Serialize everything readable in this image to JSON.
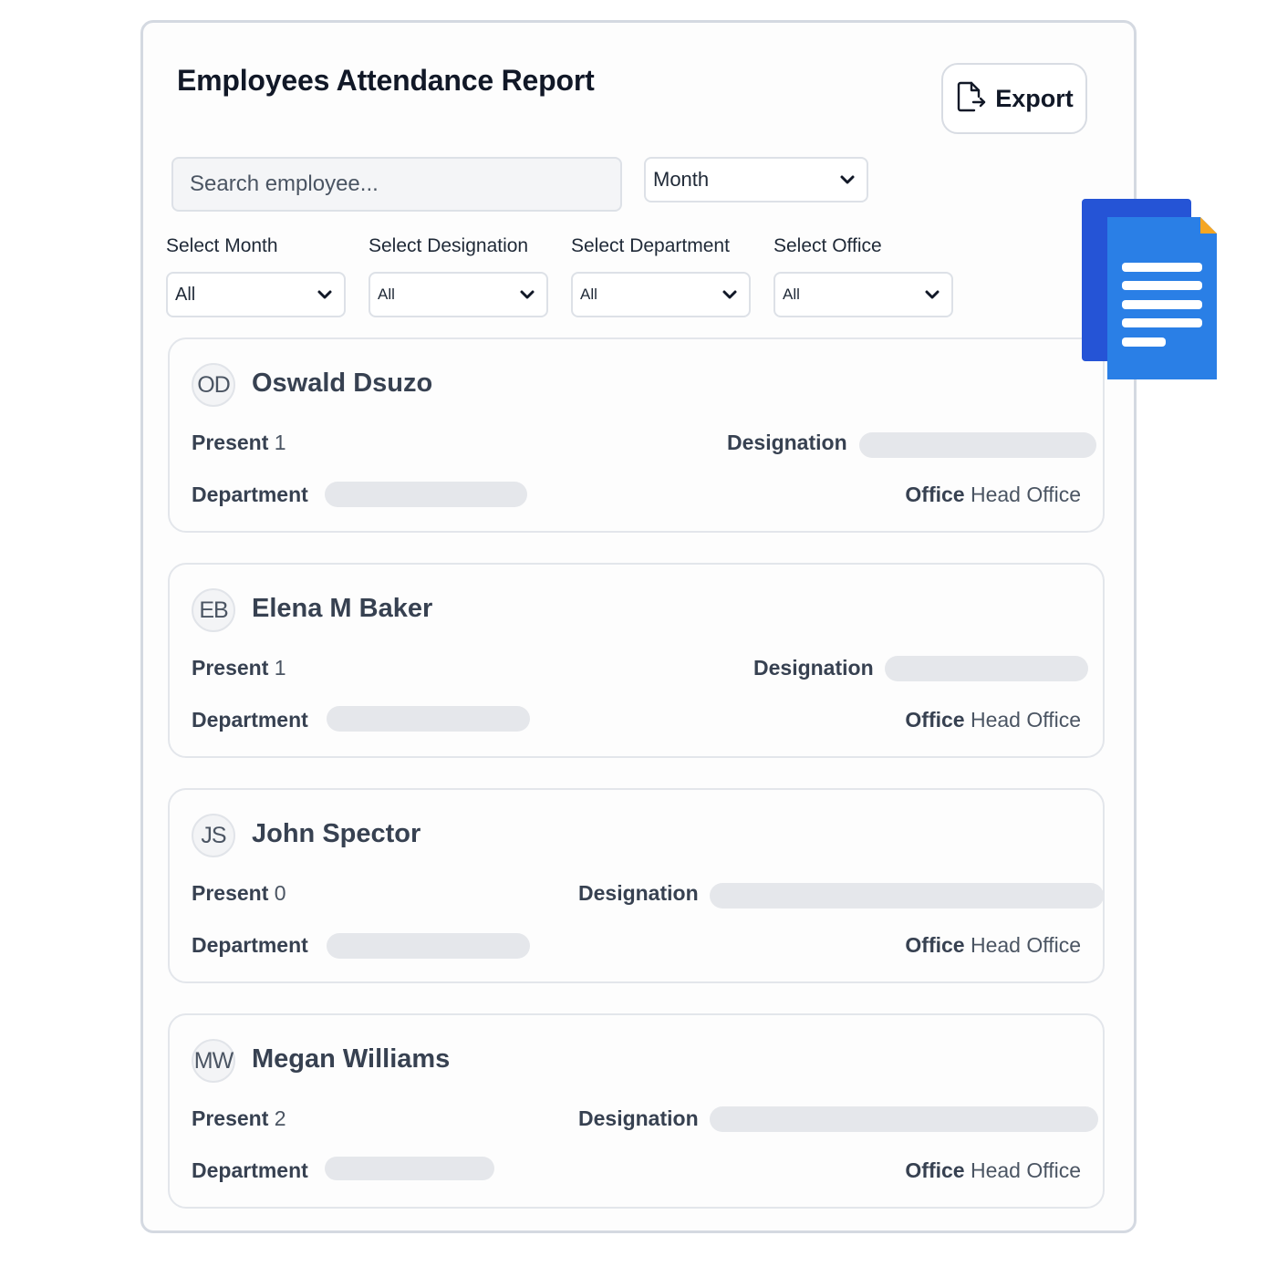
{
  "header": {
    "title": "Employees Attendance Report",
    "export_label": "Export"
  },
  "toolbar": {
    "search_placeholder": "Search employee...",
    "period_select": "Month"
  },
  "filters": [
    {
      "label": "Select Month",
      "value": "All"
    },
    {
      "label": "Select Designation",
      "value": "All"
    },
    {
      "label": "Select Department",
      "value": "All"
    },
    {
      "label": "Select Office",
      "value": "All"
    }
  ],
  "employees": [
    {
      "initials": "OD",
      "name": "Oswald Dsuzo",
      "present_label": "Present",
      "present": "1",
      "designation_label": "Designation",
      "department_label": "Department",
      "office_label": "Office",
      "office": "Head Office"
    },
    {
      "initials": "EB",
      "name": "Elena M Baker",
      "present_label": "Present",
      "present": "1",
      "designation_label": "Designation",
      "department_label": "Department",
      "office_label": "Office",
      "office": "Head Office"
    },
    {
      "initials": "JS",
      "name": "John Spector",
      "present_label": "Present",
      "present": "0",
      "designation_label": "Designation",
      "department_label": "Department",
      "office_label": "Office",
      "office": "Head Office"
    },
    {
      "initials": "MW",
      "name": "Megan Williams",
      "present_label": "Present",
      "present": "2",
      "designation_label": "Designation",
      "department_label": "Department",
      "office_label": "Office",
      "office": "Head Office"
    }
  ],
  "colors": {
    "doc_icon_back": "#2554d6",
    "doc_icon_front": "#2a7fe6",
    "doc_icon_corner": "#f5a623"
  }
}
